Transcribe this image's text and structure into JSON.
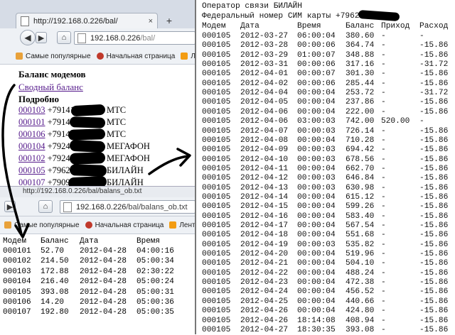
{
  "browser_top": {
    "tab_label": "http://192.168.0.226/bal/",
    "new_tab_label": "+",
    "url_host": "192.168.0.226",
    "url_path": "/bal/",
    "bookmarks": [
      "Самые популярные",
      "Начальная страница",
      "Лент"
    ]
  },
  "page_top": {
    "heading": "Баланс модемов",
    "summary_link": "Сводный баланс",
    "detail_heading": "Подробно",
    "rows": [
      {
        "modem": "000103",
        "phone": "+79141",
        "operator": "МТС"
      },
      {
        "modem": "000101",
        "phone": "+79143",
        "operator": "МТС"
      },
      {
        "modem": "000106",
        "phone": "+7914",
        "operator": "МТС"
      },
      {
        "modem": "000104",
        "phone": "+7924",
        "operator": "МЕГАФОН"
      },
      {
        "modem": "000102",
        "phone": "+7924",
        "operator": "МЕГАФОН"
      },
      {
        "modem": "000105",
        "phone": "+7962",
        "operator": "БИЛАЙН"
      },
      {
        "modem": "000107",
        "phone": "+7909",
        "operator": "БИЛАЙН"
      }
    ]
  },
  "browser_bottom": {
    "title_partial": "http://192.168.0.226/bal/balans_ob.txt",
    "url_host": "192.168.0.226",
    "url_path": "/bal/balans_ob.txt",
    "bookmarks": [
      "Самые популярные",
      "Начальная страница",
      "Лента но"
    ]
  },
  "summary_table": {
    "headers": [
      "Модем",
      "Баланс",
      "Дата",
      "Время"
    ],
    "rows": [
      [
        "000101",
        "52.70",
        "2012-04-28",
        "04:00:16"
      ],
      [
        "000102",
        "214.50",
        "2012-04-28",
        "05:00:34"
      ],
      [
        "000103",
        "172.88",
        "2012-04-28",
        "02:30:22"
      ],
      [
        "000104",
        "216.40",
        "2012-04-28",
        "05:00:24"
      ],
      [
        "000105",
        "393.08",
        "2012-04-28",
        "05:00:31"
      ],
      [
        "000106",
        "14.20",
        "2012-04-28",
        "05:00:36"
      ],
      [
        "000107",
        "192.80",
        "2012-04-28",
        "05:00:35"
      ]
    ]
  },
  "detail_file": {
    "operator_line": "Оператор связи БИЛАЙН",
    "sim_line": "Федеральный номер СИМ карты +7962",
    "headers": [
      "Модем",
      "Дата",
      "Время",
      "Баланс",
      "Приход",
      "Расход"
    ],
    "rows": [
      [
        "000105",
        "2012-03-27",
        "06:00:04",
        "380.60",
        "-",
        "-"
      ],
      [
        "000105",
        "2012-03-28",
        "00:00:06",
        "364.74",
        "-",
        "-15.86"
      ],
      [
        "000105",
        "2012-03-29",
        "01:00:07",
        "348.88",
        "-",
        "-15.86"
      ],
      [
        "000105",
        "2012-03-31",
        "00:00:06",
        "317.16",
        "-",
        "-31.72"
      ],
      [
        "000105",
        "2012-04-01",
        "00:00:07",
        "301.30",
        "-",
        "-15.86"
      ],
      [
        "000105",
        "2012-04-02",
        "00:00:06",
        "285.44",
        "-",
        "-15.86"
      ],
      [
        "000105",
        "2012-04-04",
        "00:00:04",
        "253.72",
        "-",
        "-31.72"
      ],
      [
        "000105",
        "2012-04-05",
        "00:00:04",
        "237.86",
        "-",
        "-15.86"
      ],
      [
        "000105",
        "2012-04-06",
        "00:00:04",
        "222.00",
        "-",
        "-15.86"
      ],
      [
        "000105",
        "2012-04-06",
        "03:00:03",
        "742.00",
        "520.00",
        "-"
      ],
      [
        "000105",
        "2012-04-07",
        "00:00:03",
        "726.14",
        "-",
        "-15.86"
      ],
      [
        "000105",
        "2012-04-08",
        "00:00:04",
        "710.28",
        "-",
        "-15.86"
      ],
      [
        "000105",
        "2012-04-09",
        "00:00:03",
        "694.42",
        "-",
        "-15.86"
      ],
      [
        "000105",
        "2012-04-10",
        "00:00:03",
        "678.56",
        "-",
        "-15.86"
      ],
      [
        "000105",
        "2012-04-11",
        "00:00:04",
        "662.70",
        "-",
        "-15.86"
      ],
      [
        "000105",
        "2012-04-12",
        "00:00:03",
        "646.84",
        "-",
        "-15.86"
      ],
      [
        "000105",
        "2012-04-13",
        "00:00:03",
        "630.98",
        "-",
        "-15.86"
      ],
      [
        "000105",
        "2012-04-14",
        "00:00:04",
        "615.12",
        "-",
        "-15.86"
      ],
      [
        "000105",
        "2012-04-15",
        "00:00:04",
        "599.26",
        "-",
        "-15.86"
      ],
      [
        "000105",
        "2012-04-16",
        "00:00:04",
        "583.40",
        "-",
        "-15.86"
      ],
      [
        "000105",
        "2012-04-17",
        "00:00:04",
        "567.54",
        "-",
        "-15.86"
      ],
      [
        "000105",
        "2012-04-18",
        "00:00:04",
        "551.68",
        "-",
        "-15.86"
      ],
      [
        "000105",
        "2012-04-19",
        "00:00:03",
        "535.82",
        "-",
        "-15.86"
      ],
      [
        "000105",
        "2012-04-20",
        "00:00:04",
        "519.96",
        "-",
        "-15.86"
      ],
      [
        "000105",
        "2012-04-21",
        "00:00:04",
        "504.10",
        "-",
        "-15.86"
      ],
      [
        "000105",
        "2012-04-22",
        "00:00:04",
        "488.24",
        "-",
        "-15.86"
      ],
      [
        "000105",
        "2012-04-23",
        "00:00:04",
        "472.38",
        "-",
        "-15.86"
      ],
      [
        "000105",
        "2012-04-24",
        "00:00:04",
        "456.52",
        "-",
        "-15.86"
      ],
      [
        "000105",
        "2012-04-25",
        "00:00:04",
        "440.66",
        "-",
        "-15.86"
      ],
      [
        "000105",
        "2012-04-26",
        "00:00:04",
        "424.80",
        "-",
        "-15.86"
      ],
      [
        "000105",
        "2012-04-26",
        "18:14:08",
        "408.94",
        "-",
        "-15.86"
      ],
      [
        "000105",
        "2012-04-27",
        "18:30:35",
        "393.08",
        "-",
        "-15.86"
      ]
    ]
  },
  "colors": {
    "link": "#551a8b",
    "chrome_bg": "#eef1f5",
    "tabstrip_bg": "#d6dce6",
    "arrow": "#000000"
  }
}
